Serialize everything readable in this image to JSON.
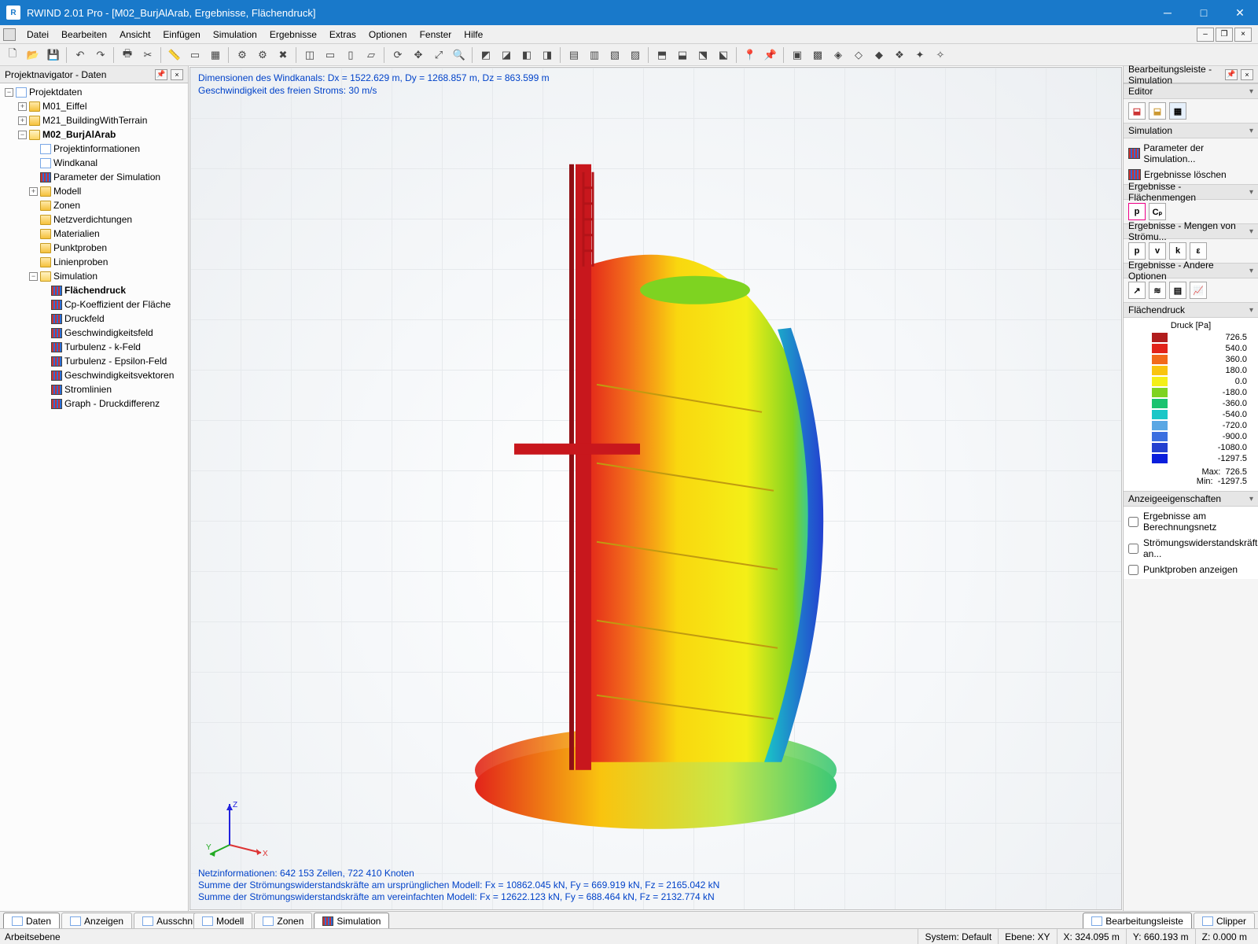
{
  "title": "RWIND 2.01 Pro - [M02_BurjAlArab, Ergebnisse, Flächendruck]",
  "menu": {
    "items": [
      "Datei",
      "Bearbeiten",
      "Ansicht",
      "Einfügen",
      "Simulation",
      "Ergebnisse",
      "Extras",
      "Optionen",
      "Fenster",
      "Hilfe"
    ]
  },
  "nav": {
    "header": "Projektnavigator - Daten",
    "root": "Projektdaten",
    "m01": "M01_Eiffel",
    "m21": "M21_BuildingWithTerrain",
    "m02": "M02_BurjAlArab",
    "projinfo": "Projektinformationen",
    "windkanal": "Windkanal",
    "simparam": "Parameter der Simulation",
    "modell": "Modell",
    "zonen": "Zonen",
    "netz": "Netzverdichtungen",
    "mat": "Materialien",
    "punktproben": "Punktproben",
    "linienproben": "Linienproben",
    "simulation": "Simulation",
    "flaechendruck": "Flächendruck",
    "cp": "Cp-Koeffizient der Fläche",
    "druckfeld": "Druckfeld",
    "geschw": "Geschwindigkeitsfeld",
    "turbk": "Turbulenz - k-Feld",
    "turbeps": "Turbulenz - Epsilon-Feld",
    "geschwvec": "Geschwindigkeitsvektoren",
    "strom": "Stromlinien",
    "graph": "Graph - Druckdifferenz"
  },
  "view": {
    "line1": "Dimensionen des Windkanals: Dx = 1522.629 m, Dy = 1268.857 m, Dz = 863.599 m",
    "line2": "Geschwindigkeit des freien Stroms: 30 m/s",
    "bot1": "Netzinformationen: 642 153 Zellen, 722 410 Knoten",
    "bot2": "Summe der Strömungswiderstandskräfte am ursprünglichen Modell: Fx = 10862.045 kN, Fy = 669.919 kN, Fz = 2165.042 kN",
    "bot3": "Summe der Strömungswiderstandskräfte am vereinfachten Modell: Fx = 12622.123 kN, Fy = 688.464 kN, Fz = 2132.774 kN",
    "axisX": "X",
    "axisY": "Y",
    "axisZ": "Z"
  },
  "right": {
    "header": "Bearbeitungsleiste - Simulation",
    "editor": "Editor",
    "simulation": "Simulation",
    "simparam": "Parameter der Simulation...",
    "simdel": "Ergebnisse löschen",
    "res_fl": "Ergebnisse - Flächenmengen",
    "res_str": "Ergebnisse - Mengen von Strömu...",
    "res_other": "Ergebnisse - Andere Optionen",
    "legend_hdr": "Flächendruck",
    "legend_title": "Druck [Pa]",
    "disp_hdr": "Anzeigeeigenschaften",
    "chk1": "Ergebnisse am Berechnungsnetz",
    "chk2": "Strömungswiderstandskräfte an...",
    "chk3": "Punktproben anzeigen",
    "maxlbl": "Max:",
    "maxval": "726.5",
    "minlbl": "Min:",
    "minval": "-1297.5",
    "p": "p",
    "cp": "Cₚ",
    "v": "v",
    "k": "k",
    "eps": "ε"
  },
  "chart_data": {
    "type": "table",
    "title": "Druck [Pa]",
    "series": [
      {
        "color": "#b11d1d",
        "value": 726.5
      },
      {
        "color": "#e2231a",
        "value": 540.0
      },
      {
        "color": "#f26a1b",
        "value": 360.0
      },
      {
        "color": "#f9c40f",
        "value": 180.0
      },
      {
        "color": "#f4ef17",
        "value": 0.0
      },
      {
        "color": "#7ed321",
        "value": -180.0
      },
      {
        "color": "#19c36f",
        "value": -360.0
      },
      {
        "color": "#1ac7c7",
        "value": -540.0
      },
      {
        "color": "#5aa7e4",
        "value": -720.0
      },
      {
        "color": "#3b6fe0",
        "value": -900.0
      },
      {
        "color": "#2340d0",
        "value": -1080.0
      },
      {
        "color": "#0a1edc",
        "value": -1297.5
      }
    ]
  },
  "tabs": {
    "left": [
      "Daten",
      "Anzeigen",
      "Ausschnitte"
    ],
    "mid": [
      "Modell",
      "Zonen",
      "Simulation"
    ],
    "right": [
      "Bearbeitungsleiste",
      "Clipper"
    ]
  },
  "status": {
    "left": "Arbeitsebene",
    "system": "System: Default",
    "ebene": "Ebene: XY",
    "x": "X:  324.095 m",
    "y": "Y:  660.193 m",
    "z": "Z:  0.000 m"
  }
}
